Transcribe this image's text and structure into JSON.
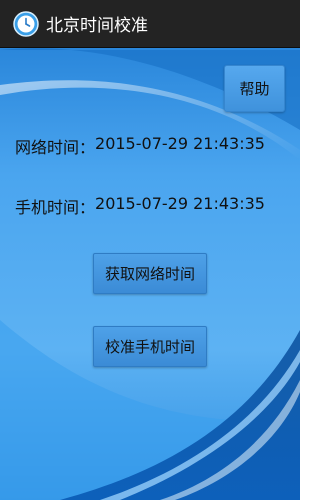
{
  "app": {
    "title": "北京时间校准",
    "icon": "clock-icon"
  },
  "help": {
    "label": "帮助"
  },
  "network_time": {
    "label": "网络时间：",
    "value": "2015-07-29 21:43:35"
  },
  "phone_time": {
    "label": "手机时间：",
    "value": "2015-07-29 21:43:35"
  },
  "actions": {
    "fetch_label": "获取网络时间",
    "calibrate_label": "校准手机时间"
  },
  "colors": {
    "titlebar": "#232323",
    "background": "#2b8fe0",
    "button": "#4499e4",
    "text": "#111111"
  }
}
